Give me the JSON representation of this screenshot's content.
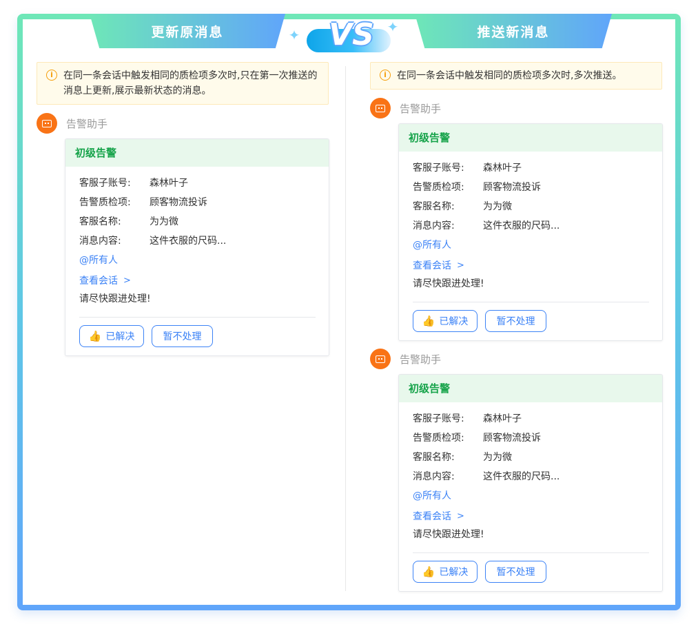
{
  "header": {
    "left_tab": "更新原消息",
    "vs": "VS",
    "right_tab": "推送新消息"
  },
  "left": {
    "notice": "在同一条会话中触发相同的质检项多次时,只在第一次推送的消息上更新,展示最新状态的消息。",
    "bot_name": "告警助手",
    "card": {
      "title": "初级告警",
      "fields": [
        {
          "k": "客服子账号:",
          "v": "森林叶子"
        },
        {
          "k": "告警质检项:",
          "v": "顾客物流投诉"
        },
        {
          "k": "客服名称:",
          "v": "为为微"
        },
        {
          "k": "消息内容:",
          "v": "这件衣服的尺码..."
        }
      ],
      "mention": "@所有人",
      "view_link": "查看会话",
      "urge": "请尽快跟进处理!",
      "resolve_button": "已解决",
      "ignore_button": "暂不处理"
    }
  },
  "right": {
    "notice": "在同一条会话中触发相同的质检项多次时,多次推送。",
    "messages": [
      {
        "bot_name": "告警助手",
        "card": {
          "title": "初级告警",
          "fields": [
            {
              "k": "客服子账号:",
              "v": "森林叶子"
            },
            {
              "k": "告警质检项:",
              "v": "顾客物流投诉"
            },
            {
              "k": "客服名称:",
              "v": "为为微"
            },
            {
              "k": "消息内容:",
              "v": "这件衣服的尺码..."
            }
          ],
          "mention": "@所有人",
          "view_link": "查看会话",
          "urge": "请尽快跟进处理!",
          "resolve_button": "已解决",
          "ignore_button": "暂不处理"
        }
      },
      {
        "bot_name": "告警助手",
        "card": {
          "title": "初级告警",
          "fields": [
            {
              "k": "客服子账号:",
              "v": "森林叶子"
            },
            {
              "k": "告警质检项:",
              "v": "顾客物流投诉"
            },
            {
              "k": "客服名称:",
              "v": "为为微"
            },
            {
              "k": "消息内容:",
              "v": "这件衣服的尺码..."
            }
          ],
          "mention": "@所有人",
          "view_link": "查看会话",
          "urge": "请尽快跟进处理!",
          "resolve_button": "已解决",
          "ignore_button": "暂不处理"
        }
      }
    ]
  },
  "colors": {
    "accent": "#3b82f6",
    "alert_green": "#16a34a",
    "bot_orange": "#f97316",
    "notice_bg": "#fffbeb"
  }
}
